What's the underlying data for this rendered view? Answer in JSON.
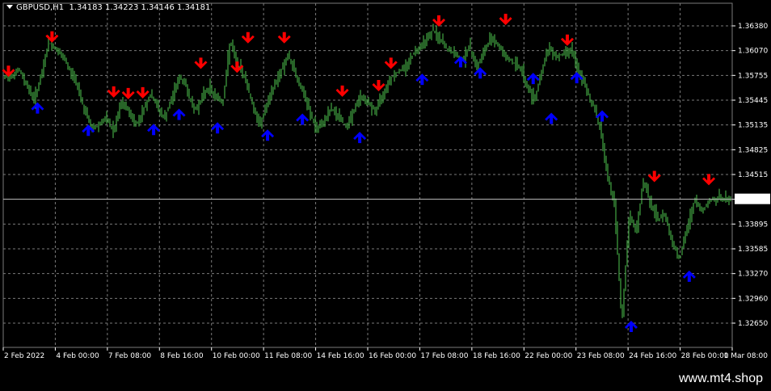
{
  "header": {
    "symbol": "GBPUSD,H1",
    "ohlc": "1.34183 1.34223 1.34146 1.34181"
  },
  "watermark": "www.mt4.shop",
  "colors": {
    "background": "#000000",
    "grid": "#7a7a7a",
    "candle": "#3e9b3e",
    "sell_arrow": "#ff0000",
    "buy_arrow": "#0000ff",
    "axis_text": "#ffffff"
  },
  "icons": {
    "sell": "arrow-down-icon",
    "buy": "arrow-up-icon"
  },
  "chart_data": {
    "type": "line",
    "grid": true,
    "y_ticks": [
      "1.36380",
      "1.36070",
      "1.35755",
      "1.35445",
      "1.35135",
      "1.34825",
      "1.34515",
      "1.34181",
      "1.33895",
      "1.33585",
      "1.33270",
      "1.32960",
      "1.32650"
    ],
    "current_price": "1.34181",
    "ylim": [
      1.3265,
      1.3638
    ],
    "x_ticks": [
      "2 Feb 2022",
      "4 Feb 00:00",
      "7 Feb 08:00",
      "8 Feb 16:00",
      "10 Feb 00:00",
      "11 Feb 08:00",
      "14 Feb 16:00",
      "16 Feb 00:00",
      "17 Feb 08:00",
      "18 Feb 16:00",
      "22 Feb 00:00",
      "23 Feb 08:00",
      "24 Feb 16:00",
      "28 Feb 00:00",
      "1 Mar 08:00"
    ],
    "xlim": [
      0,
      100
    ],
    "series": [
      {
        "x": [
          0,
          2,
          4,
          5,
          6,
          7,
          8,
          10,
          11,
          12,
          14,
          15,
          16,
          17,
          18,
          20,
          22,
          24,
          25,
          26,
          28,
          30,
          31,
          32,
          33,
          35,
          37,
          39,
          41,
          42,
          43,
          45,
          47,
          49,
          51,
          53,
          55,
          57,
          59,
          61,
          63,
          64,
          65,
          66,
          67,
          69,
          71,
          72,
          73,
          74,
          75,
          76,
          78,
          79,
          80,
          81,
          82,
          83,
          84,
          85,
          86,
          87,
          88,
          89,
          90,
          91,
          92,
          93,
          94,
          95,
          96,
          97,
          98,
          100
        ],
        "values": [
          1.3572,
          1.3582,
          1.3545,
          1.3575,
          1.3618,
          1.3608,
          1.3598,
          1.3565,
          1.353,
          1.3508,
          1.3521,
          1.3505,
          1.3541,
          1.3532,
          1.3512,
          1.3552,
          1.3521,
          1.3574,
          1.3562,
          1.353,
          1.3561,
          1.354,
          1.3618,
          1.359,
          1.3575,
          1.3512,
          1.3561,
          1.3601,
          1.3555,
          1.353,
          1.3505,
          1.3535,
          1.3512,
          1.355,
          1.3531,
          1.3572,
          1.3585,
          1.3612,
          1.3632,
          1.3608,
          1.3595,
          1.3612,
          1.3585,
          1.3605,
          1.3625,
          1.36,
          1.3585,
          1.356,
          1.3545,
          1.3585,
          1.3612,
          1.3598,
          1.361,
          1.358,
          1.356,
          1.354,
          1.351,
          1.345,
          1.3412,
          1.3265,
          1.34,
          1.338,
          1.3445,
          1.3412,
          1.3395,
          1.34,
          1.3365,
          1.3345,
          1.3385,
          1.342,
          1.3405,
          1.3418,
          1.3422,
          1.3418
        ]
      }
    ],
    "sell_signals": [
      {
        "x": 0.5,
        "y": 1.3579
      },
      {
        "x": 6.5,
        "y": 1.3622
      },
      {
        "x": 15,
        "y": 1.3553
      },
      {
        "x": 17,
        "y": 1.3551
      },
      {
        "x": 19,
        "y": 1.3552
      },
      {
        "x": 27,
        "y": 1.3589
      },
      {
        "x": 32,
        "y": 1.3584
      },
      {
        "x": 33.5,
        "y": 1.3621
      },
      {
        "x": 38.5,
        "y": 1.3621
      },
      {
        "x": 46.5,
        "y": 1.3554
      },
      {
        "x": 51.5,
        "y": 1.3561
      },
      {
        "x": 53.2,
        "y": 1.3589
      },
      {
        "x": 59.8,
        "y": 1.3642
      },
      {
        "x": 69,
        "y": 1.3644
      },
      {
        "x": 77.5,
        "y": 1.3618
      },
      {
        "x": 89.5,
        "y": 1.3447
      },
      {
        "x": 97,
        "y": 1.3443
      }
    ],
    "buy_signals": [
      {
        "x": 4.5,
        "y": 1.3537
      },
      {
        "x": 11.5,
        "y": 1.3509
      },
      {
        "x": 20.5,
        "y": 1.351
      },
      {
        "x": 24,
        "y": 1.3529
      },
      {
        "x": 29.3,
        "y": 1.3512
      },
      {
        "x": 36.2,
        "y": 1.3503
      },
      {
        "x": 41,
        "y": 1.3523
      },
      {
        "x": 48.9,
        "y": 1.35
      },
      {
        "x": 57.5,
        "y": 1.3573
      },
      {
        "x": 62.8,
        "y": 1.3595
      },
      {
        "x": 65.5,
        "y": 1.3581
      },
      {
        "x": 72.8,
        "y": 1.3574
      },
      {
        "x": 75.3,
        "y": 1.3524
      },
      {
        "x": 78.8,
        "y": 1.3575
      },
      {
        "x": 82.3,
        "y": 1.3527
      },
      {
        "x": 86.3,
        "y": 1.3263
      },
      {
        "x": 94.3,
        "y": 1.3326
      }
    ]
  }
}
